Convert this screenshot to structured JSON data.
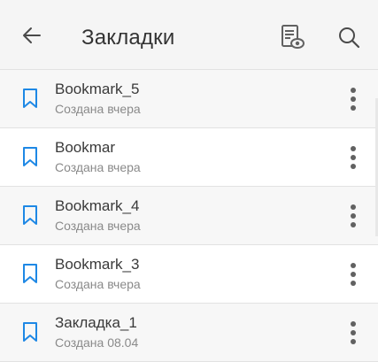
{
  "appbar": {
    "title": "Закладки",
    "icons": [
      "arrow-back-icon",
      "document-view-icon",
      "search-icon"
    ]
  },
  "bookmarks": [
    {
      "title": "Bookmark_5",
      "subtitle": "Создана вчера"
    },
    {
      "title": "Bookmar",
      "subtitle": "Создана вчера"
    },
    {
      "title": "Bookmark_4",
      "subtitle": "Создана вчера"
    },
    {
      "title": "Bookmark_3",
      "subtitle": "Создана вчера"
    },
    {
      "title": "Закладка_1",
      "subtitle": "Создана 08.04"
    }
  ],
  "colors": {
    "accent": "#1e88e5",
    "title_text": "#333333",
    "subtitle_text": "#8a8a8a",
    "icon_gray": "#616161"
  }
}
